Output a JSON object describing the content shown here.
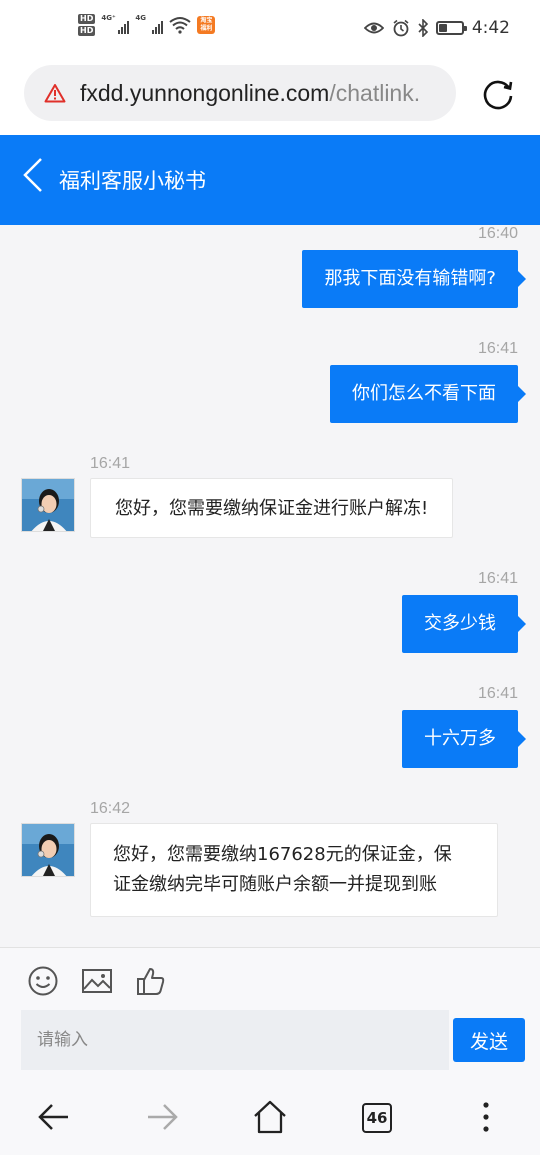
{
  "status_bar": {
    "hd1": "HD",
    "hd2": "HD",
    "net1": "4G⁺",
    "net2": "4G",
    "time": "4:42",
    "battery_level": 0.35,
    "app_badge": "淘宝\n福利"
  },
  "browser": {
    "url_domain": "fxdd.yunnongonline.com",
    "url_path": "/chatlink."
  },
  "header": {
    "title": "福利客服小秘书"
  },
  "messages": [
    {
      "side": "right",
      "time": "16:40",
      "text": "那我下面没有输错啊?"
    },
    {
      "side": "right",
      "time": "16:41",
      "text": "你们怎么不看下面"
    },
    {
      "side": "left",
      "time": "16:41",
      "text": "您好，您需要缴纳保证金进行账户解冻!"
    },
    {
      "side": "right",
      "time": "16:41",
      "text": "交多少钱"
    },
    {
      "side": "right",
      "time": "16:41",
      "text": "十六万多"
    },
    {
      "side": "left",
      "time": "16:42",
      "text_line1": "您好，您需要缴纳167628元的保证金，保",
      "text_line2": "证金缴纳完毕可随账户余额一并提现到账"
    }
  ],
  "composer": {
    "placeholder": "请输入",
    "send_label": "发送"
  },
  "nav": {
    "tab_count": "46"
  },
  "colors": {
    "accent": "#0a7bf7",
    "chat_bg": "#f5f5f7"
  }
}
